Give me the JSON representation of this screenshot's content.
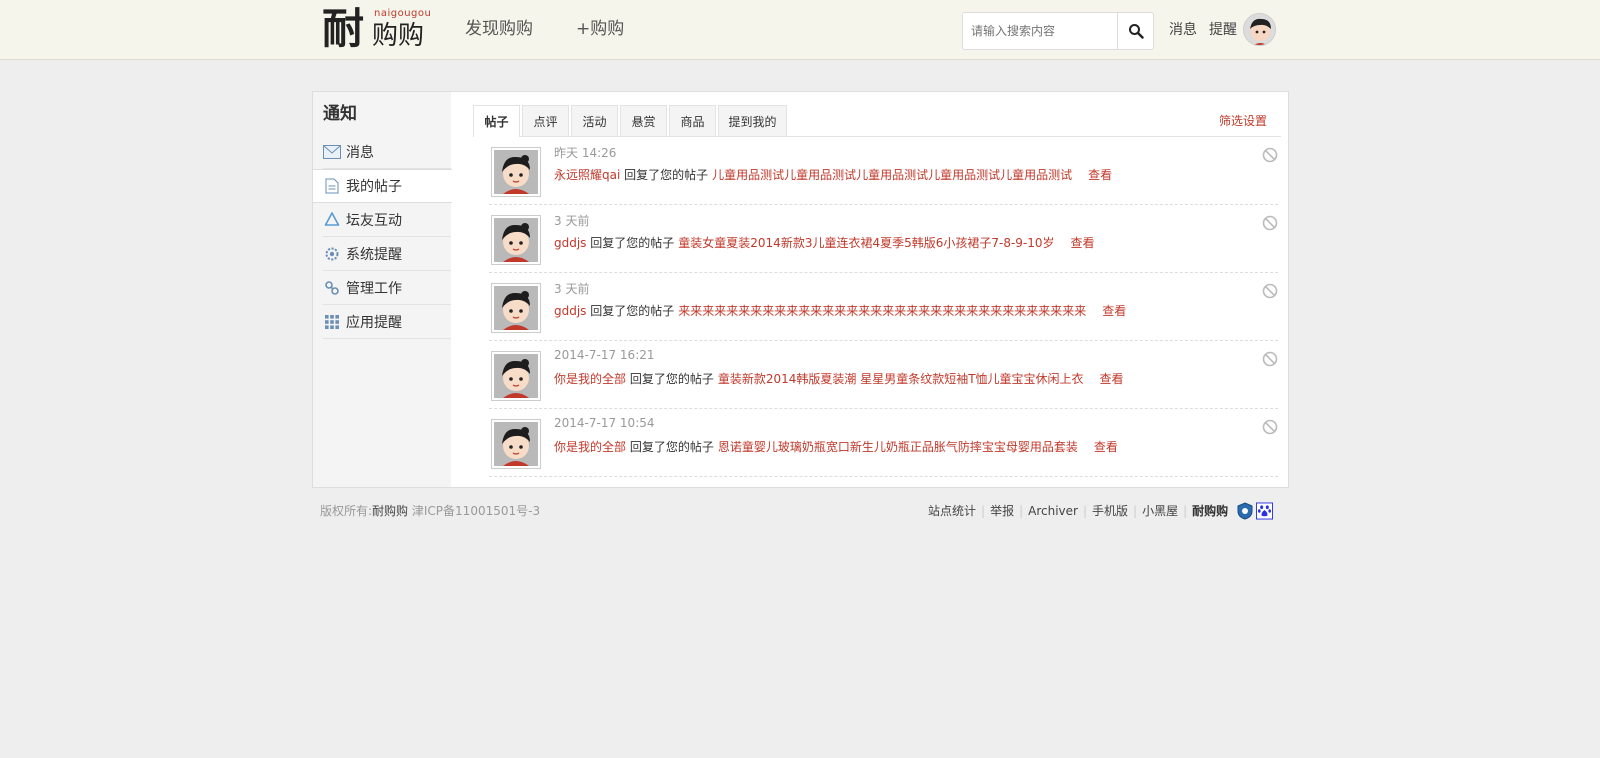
{
  "header": {
    "logo": {
      "main": "耐",
      "sub": "naigougou",
      "gou": "购购"
    },
    "nav": [
      "发现购购",
      "+购购"
    ],
    "search_placeholder": "请输入搜索内容",
    "search_icon": "search-icon",
    "links": {
      "messages": "消息",
      "reminders": "提醒"
    }
  },
  "sidebar": {
    "title": "通知",
    "items": [
      {
        "label": "消息",
        "icon": "envelope-icon"
      },
      {
        "label": "我的帖子",
        "icon": "document-icon"
      },
      {
        "label": "坛友互动",
        "icon": "recycle-icon"
      },
      {
        "label": "系统提醒",
        "icon": "gear-icon"
      },
      {
        "label": "管理工作",
        "icon": "link-icon"
      },
      {
        "label": "应用提醒",
        "icon": "grid-icon"
      }
    ],
    "active_index": 1
  },
  "tabs": [
    "帖子",
    "点评",
    "活动",
    "悬赏",
    "商品",
    "提到我的"
  ],
  "active_tab": 0,
  "filter_label": "筛选设置",
  "notices": [
    {
      "time": "昨天 14:26",
      "user": "永远照耀qai",
      "action": "回复了您的帖子",
      "subject": "儿童用品测试儿童用品测试儿童用品测试儿童用品测试儿童用品测试",
      "view": "查看"
    },
    {
      "time": "3 天前",
      "user": "gddjs",
      "action": "回复了您的帖子",
      "subject": "童装女童夏装2014新款3儿童连衣裙4夏季5韩版6小孩裙子7-8-9-10岁",
      "view": "查看"
    },
    {
      "time": "3 天前",
      "user": "gddjs",
      "action": "回复了您的帖子",
      "subject": "来来来来来来来来来来来来来来来来来来来来来来来来来来来来来来来来来来",
      "view": "查看"
    },
    {
      "time": "2014-7-17 16:21",
      "user": "你是我的全部",
      "action": "回复了您的帖子",
      "subject": "童装新款2014韩版夏装潮 星星男童条纹款短袖T恤儿童宝宝休闲上衣",
      "view": "查看"
    },
    {
      "time": "2014-7-17 10:54",
      "user": "你是我的全部",
      "action": "回复了您的帖子",
      "subject": "恩诺童婴儿玻璃奶瓶宽口新生儿奶瓶正品胀气防摔宝宝母婴用品套装",
      "view": "查看"
    }
  ],
  "footer": {
    "copyright_prefix": "版权所有:",
    "site": "耐购购",
    "icp": "津ICP备11001501号-3",
    "links": [
      "站点统计",
      "举报",
      "Archiver",
      "手机版",
      "小黑屋"
    ],
    "brand": "耐购购"
  },
  "colors": {
    "accent": "#c0392b",
    "topbar": "#f5f5eb",
    "background": "#eeeeee"
  }
}
